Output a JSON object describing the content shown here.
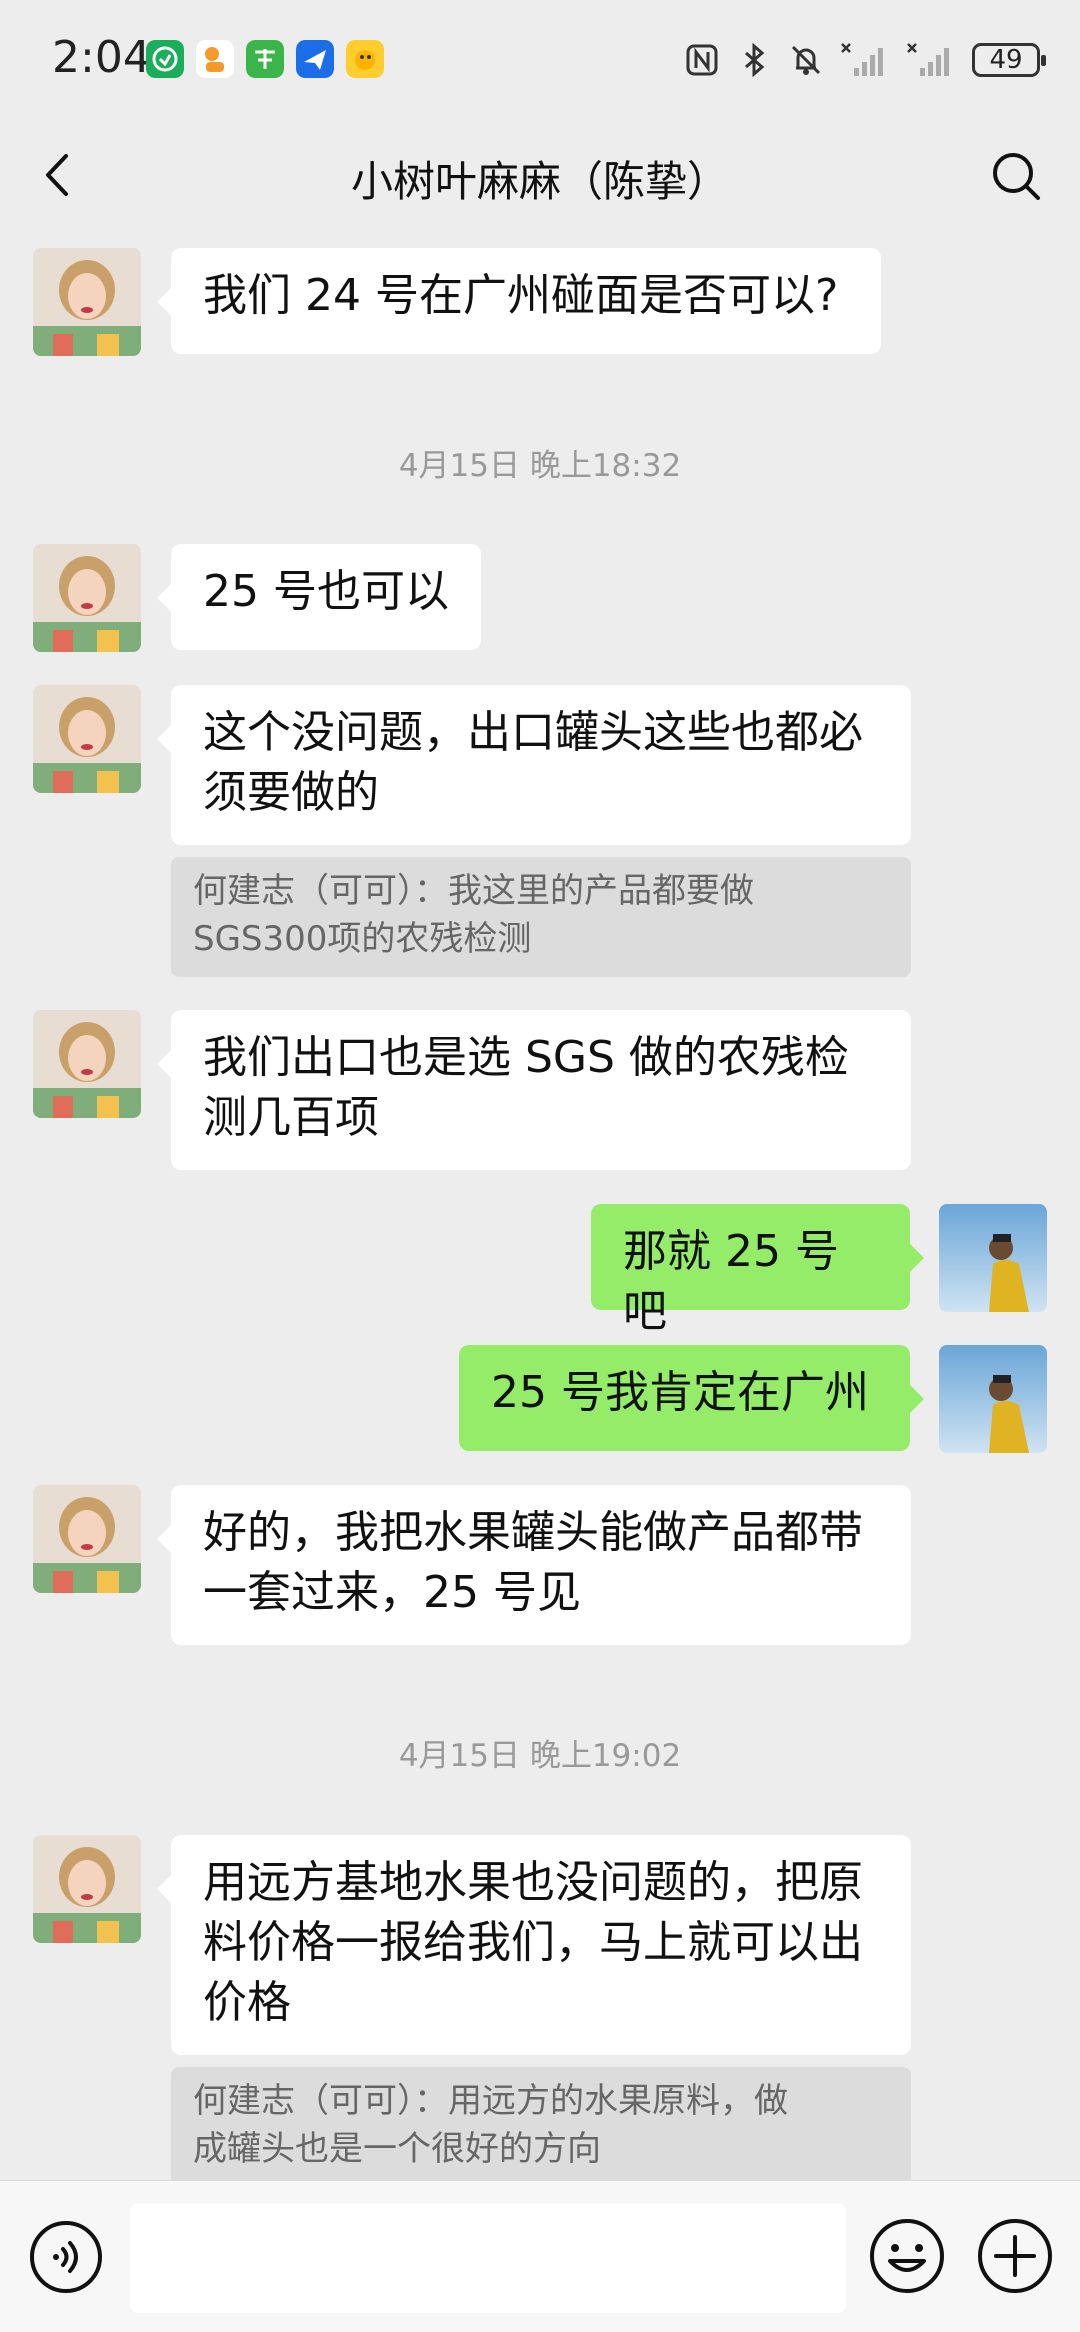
{
  "status_bar": {
    "time": "2:04",
    "battery": "49",
    "app_icons": [
      "phone-app-icon",
      "kids-app-icon",
      "grid-app-icon",
      "plane-app-icon",
      "duck-app-icon"
    ],
    "system_icons": [
      "nfc-icon",
      "bluetooth-icon",
      "mute-icon",
      "signal-icon",
      "signal-icon"
    ]
  },
  "header": {
    "title": "小树叶麻麻（陈挚）"
  },
  "messages": [
    {
      "id": "m1",
      "side": "left",
      "lines": [
        "我们 24 号在广州碰面是否可以?"
      ]
    },
    {
      "id": "t1",
      "type": "timestamp",
      "text": "4月15日 晚上18:32"
    },
    {
      "id": "m2",
      "side": "left",
      "lines": [
        "25 号也可以"
      ]
    },
    {
      "id": "m3",
      "side": "left",
      "lines": [
        "这个没问题，出口罐头这些也都必",
        "须要做的"
      ],
      "quote": [
        "何建志（可可）：我这里的产品都要做",
        "SGS300项的农残检测"
      ]
    },
    {
      "id": "m4",
      "side": "left",
      "lines": [
        "我们出口也是选 SGS 做的农残检",
        "测几百项"
      ]
    },
    {
      "id": "m5",
      "side": "right",
      "lines": [
        "那就 25 号吧"
      ]
    },
    {
      "id": "m6",
      "side": "right",
      "lines": [
        "25 号我肯定在广州"
      ]
    },
    {
      "id": "m7",
      "side": "left",
      "lines": [
        "好的，我把水果罐头能做产品都带",
        "一套过来，25 号见"
      ]
    },
    {
      "id": "t2",
      "type": "timestamp",
      "text": "4月15日 晚上19:02"
    },
    {
      "id": "m8",
      "side": "left",
      "lines": [
        "用远方基地水果也没问题的，把原",
        "料价格一报给我们，马上就可以出",
        "价格"
      ],
      "quote": [
        "何建志（可可）：用远方的水果原料，做",
        "成罐头也是一个很好的方向"
      ]
    }
  ],
  "input_bar": {
    "icons": [
      "voice-icon",
      "emoji-icon",
      "plus-icon"
    ],
    "text_value": ""
  },
  "colors": {
    "background": "#ededed",
    "sent_bubble": "#95ec69",
    "received_bubble": "#ffffff",
    "quote_bg": "#dcdcdc"
  }
}
